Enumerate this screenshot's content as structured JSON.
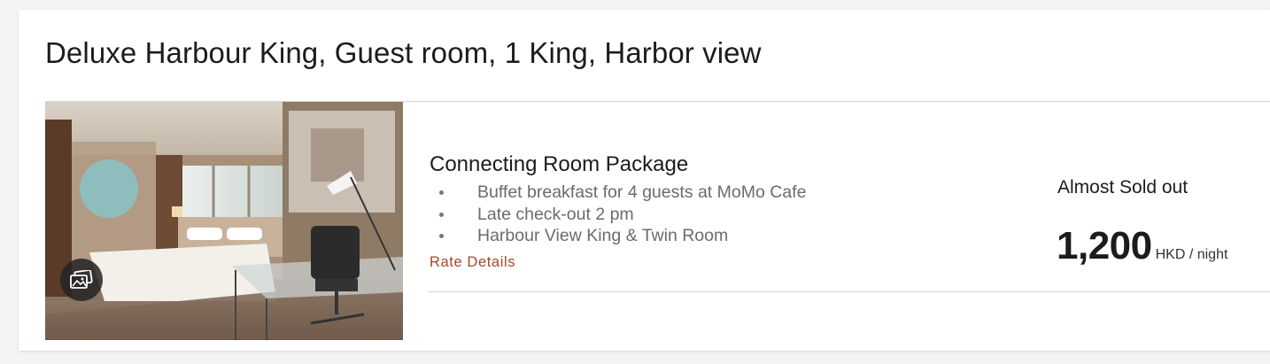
{
  "room": {
    "title": "Deluxe Harbour King, Guest room, 1 King, Harbor view",
    "photo_icon": "gallery-icon"
  },
  "rate": {
    "package_name": "Connecting Room Package",
    "features": [
      "Buffet breakfast for 4 guests at MoMo Cafe",
      "Late check-out 2 pm",
      "Harbour View King & Twin Room"
    ],
    "details_link": "Rate Details",
    "availability": "Almost Sold out",
    "price": "1,200",
    "price_unit": "HKD / night"
  },
  "colors": {
    "link": "#a4482a",
    "text": "#1c1c1c",
    "muted": "#6b6b6b"
  }
}
